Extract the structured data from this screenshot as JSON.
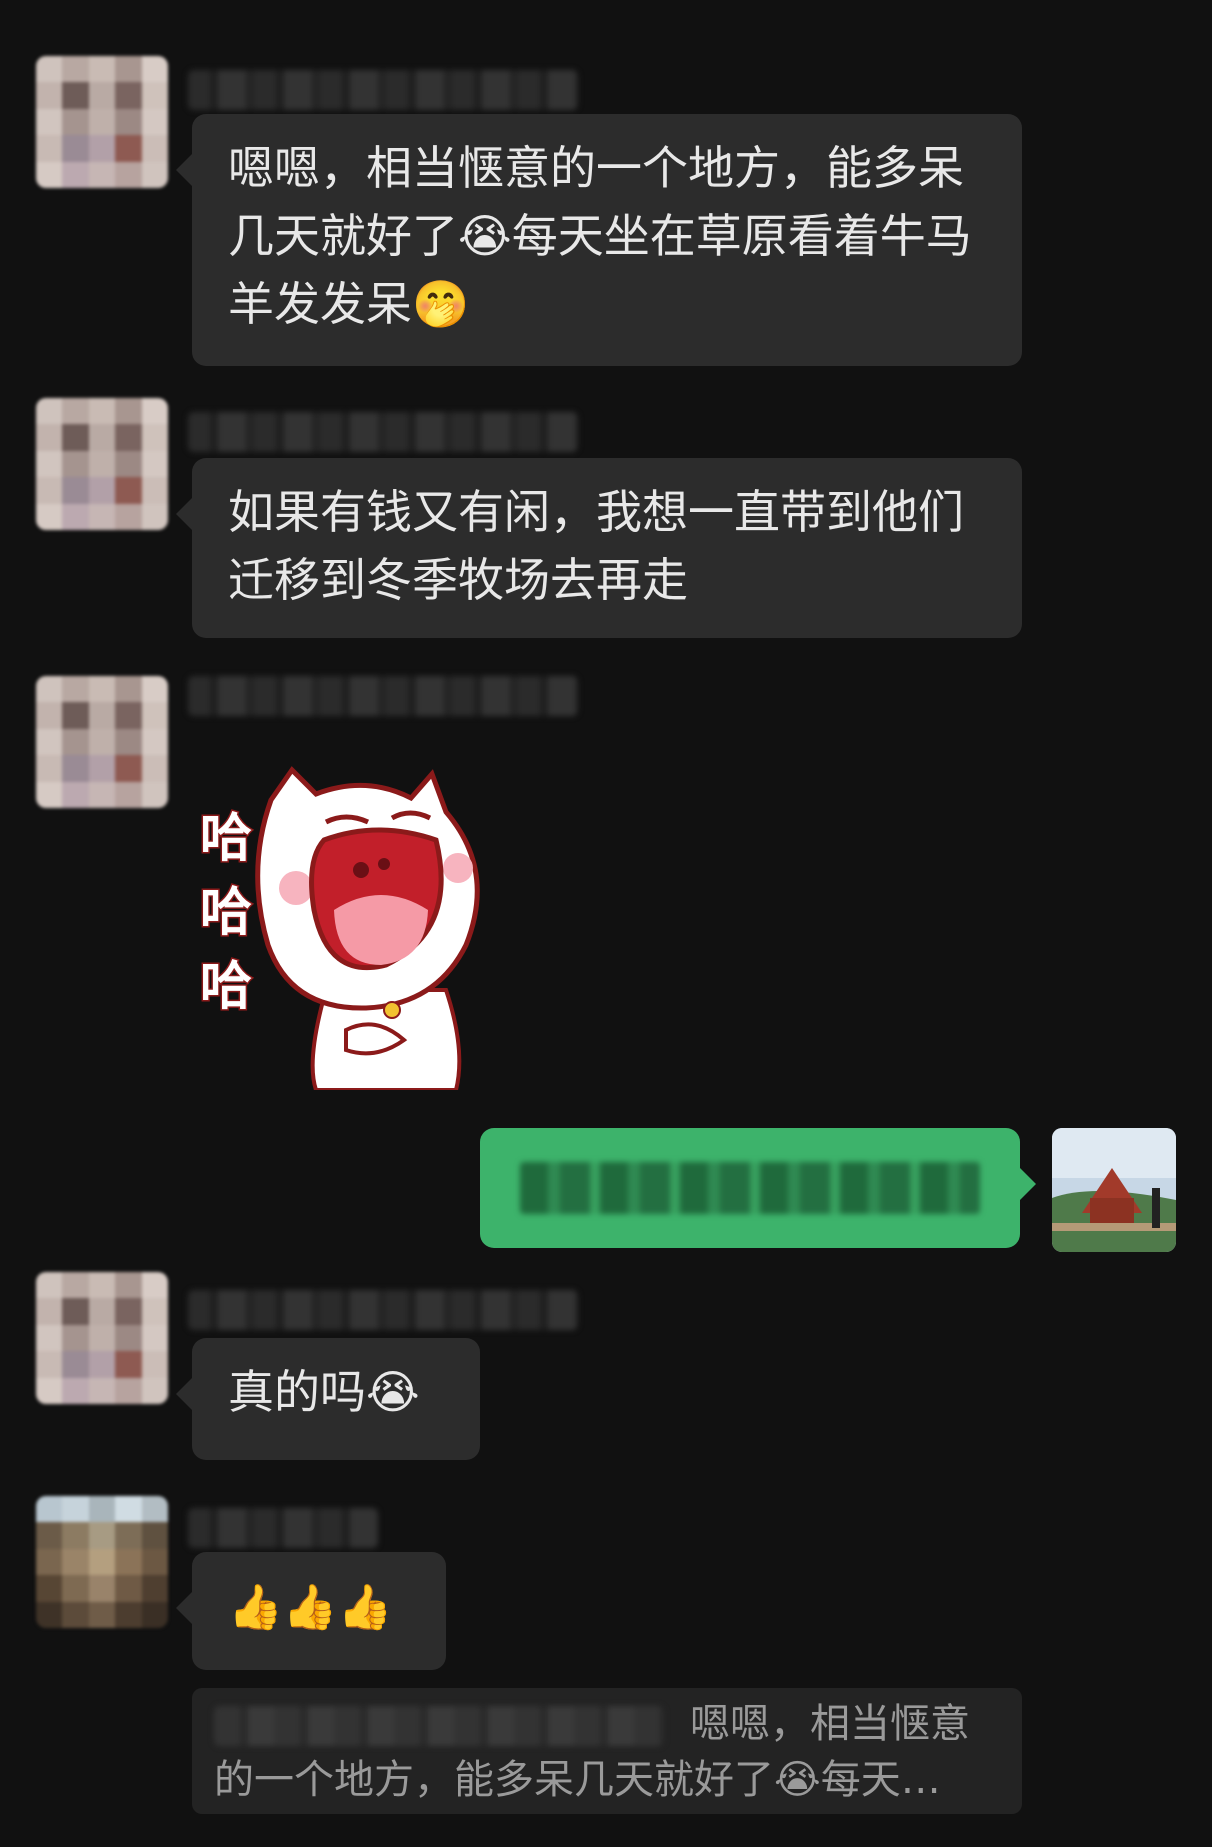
{
  "messages": [
    {
      "id": "m1",
      "text": "嗯嗯，相当惬意的一个地方，能多呆几天就好了😭每天坐在草原看着牛马羊发发呆🤭"
    },
    {
      "id": "m2",
      "text": "如果有钱又有闲，我想一直带到他们迁移到冬季牧场去再走"
    },
    {
      "id": "m3",
      "sticker_text": "哈\n哈\n哈"
    },
    {
      "id": "m5",
      "text": "真的吗😭"
    },
    {
      "id": "m6",
      "text": "👍👍👍"
    }
  ],
  "quote": {
    "text": "嗯嗯，相当惬意的一个地方，能多呆几天就好了😭每天…"
  },
  "colors": {
    "background": "#111111",
    "bubble_in": "#2c2c2c",
    "bubble_out": "#3db36b",
    "text": "#e8e8e8"
  }
}
